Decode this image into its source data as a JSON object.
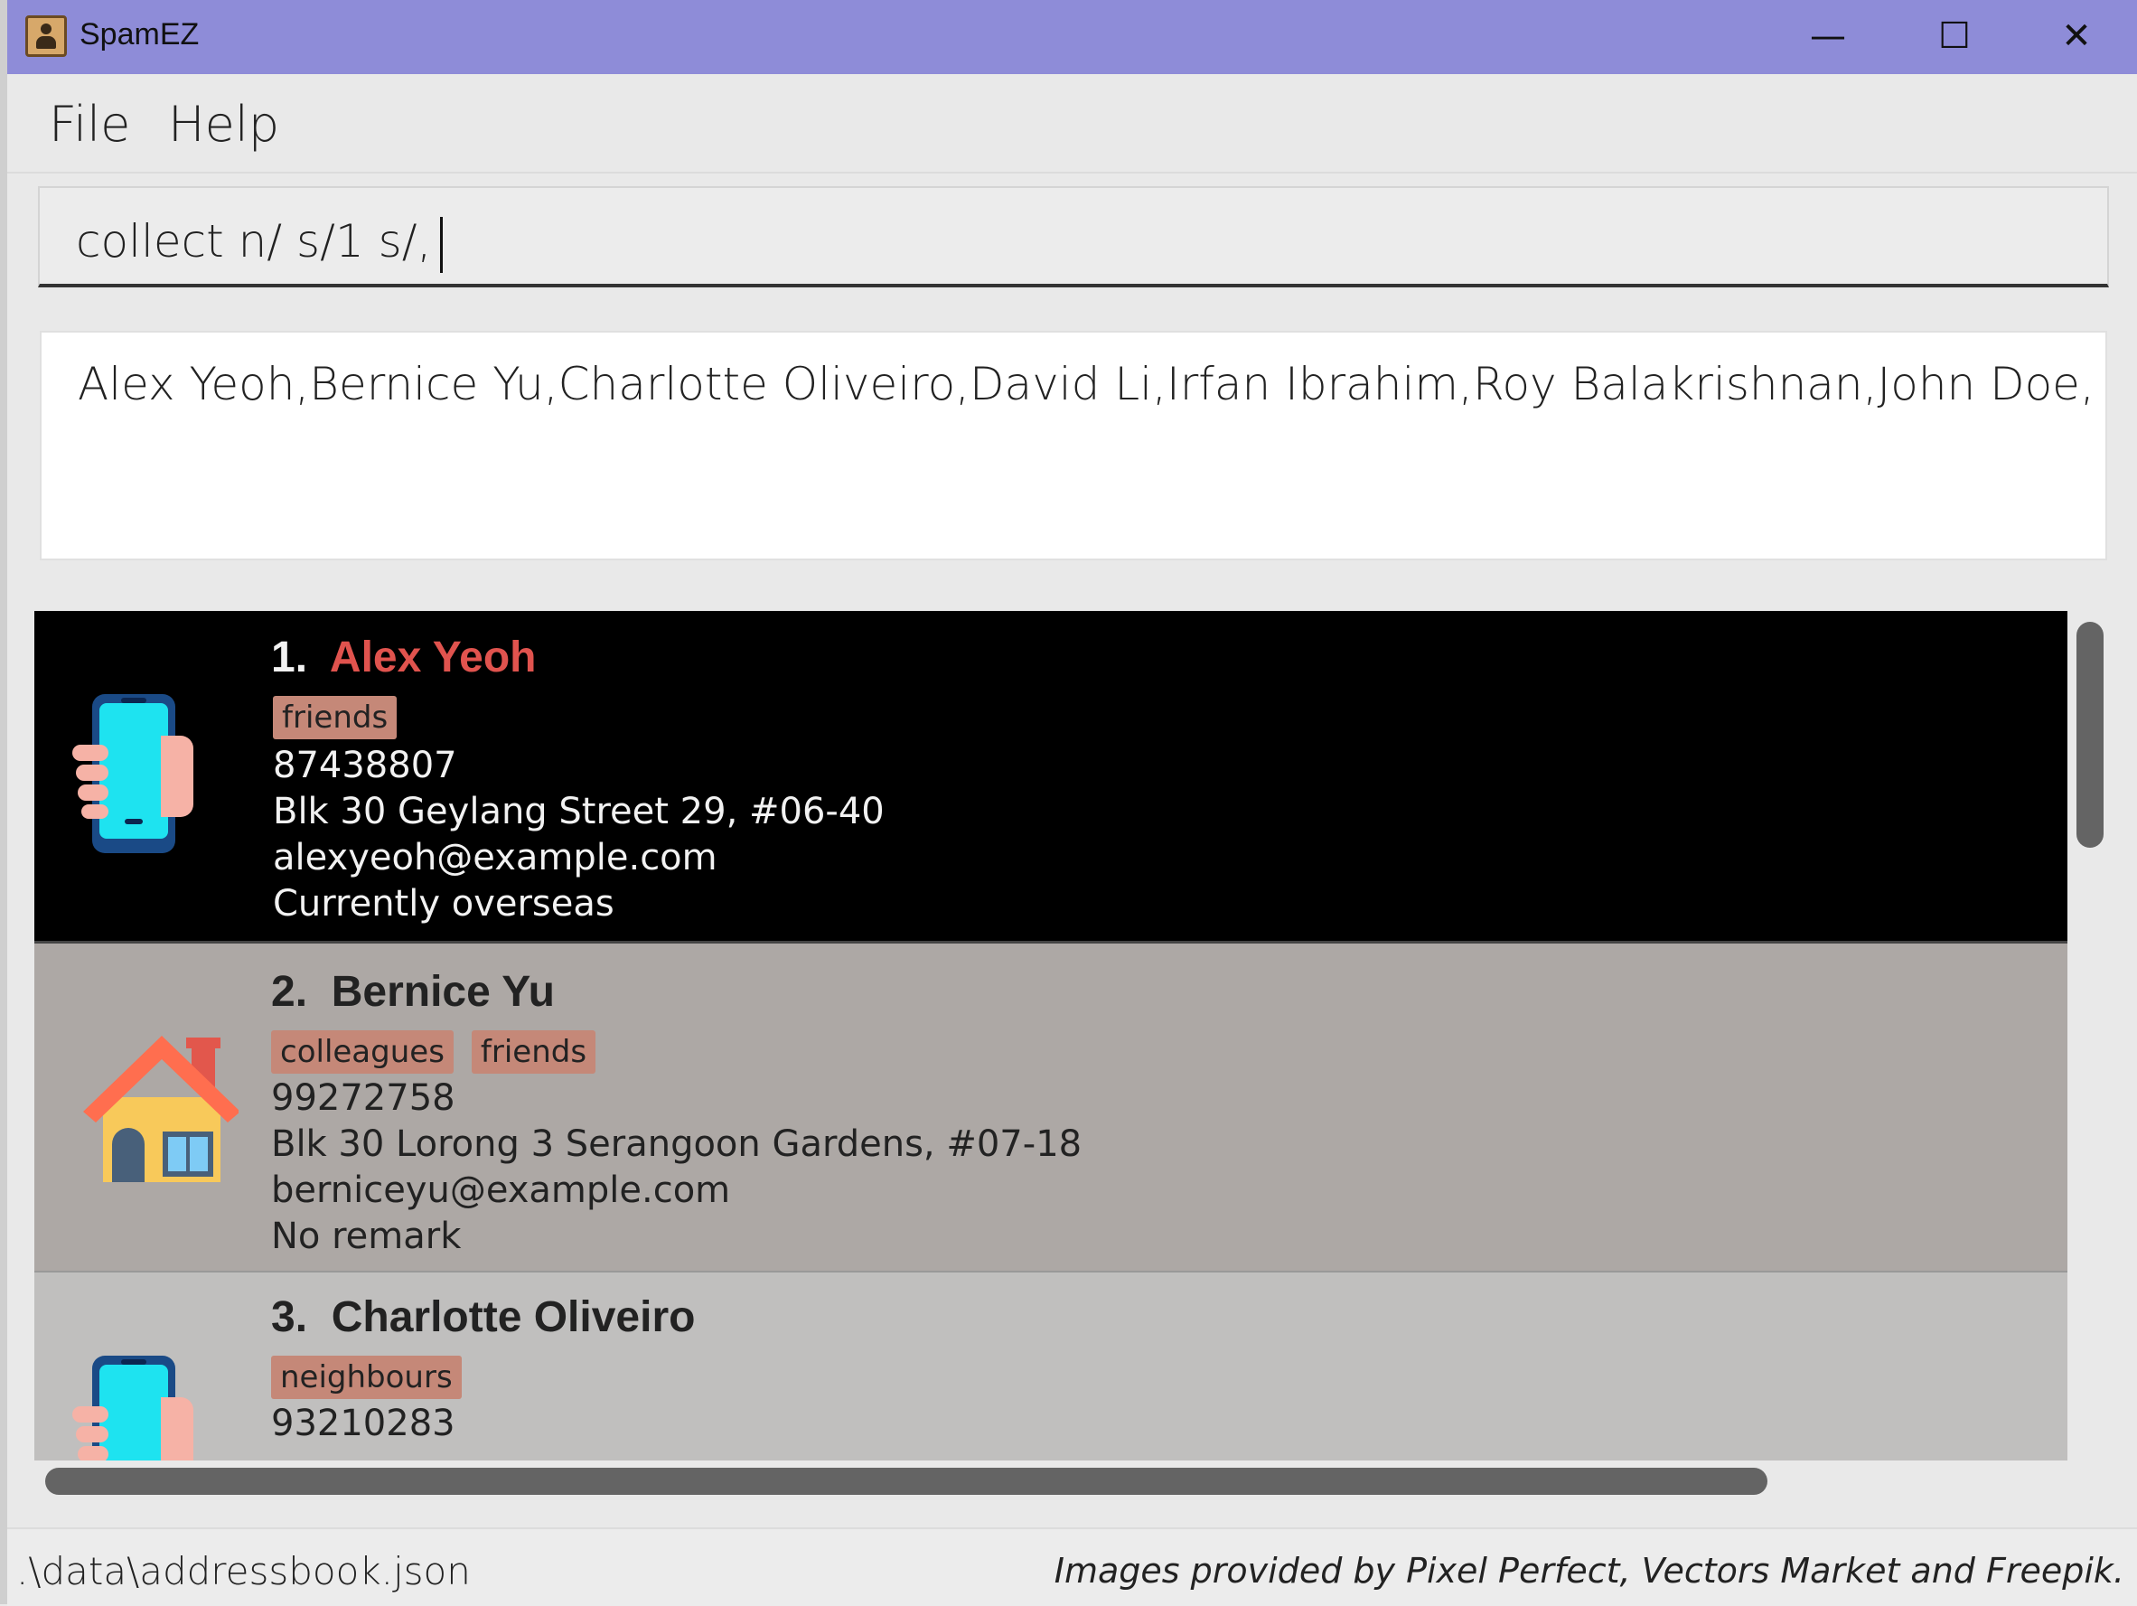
{
  "window": {
    "title": "SpamEZ"
  },
  "menu": {
    "file": "File",
    "help": "Help"
  },
  "command": {
    "value": "collect n/ s/1 s/,"
  },
  "result": {
    "text": "Alex Yeoh,Bernice Yu,Charlotte Oliveiro,David Li,Irfan Ibrahim,Roy Balakrishnan,John Doe,"
  },
  "persons": [
    {
      "index": "1.",
      "name": "Alex Yeoh",
      "tags": [
        "friends"
      ],
      "phone": "87438807",
      "address": "Blk 30 Geylang Street 29, #06-40",
      "email": "alexyeoh@example.com",
      "remark": "Currently overseas",
      "icon": "phone-in-hand-icon",
      "selected": true
    },
    {
      "index": "2.",
      "name": "Bernice Yu",
      "tags": [
        "colleagues",
        "friends"
      ],
      "phone": "99272758",
      "address": "Blk 30 Lorong 3 Serangoon Gardens, #07-18",
      "email": "berniceyu@example.com",
      "remark": "No remark",
      "icon": "house-icon",
      "selected": false
    },
    {
      "index": "3.",
      "name": "Charlotte Oliveiro",
      "tags": [
        "neighbours"
      ],
      "phone": "93210283",
      "icon": "phone-in-hand-icon",
      "selected": false
    }
  ],
  "status": {
    "path": ".\\data\\addressbook.json",
    "credit": "Images provided by Pixel Perfect, Vectors Market and Freepik."
  },
  "colors": {
    "titlebar": "#8e8cd8",
    "selected_card": "#000000",
    "selected_name": "#e0534e",
    "tag": "#c58878",
    "card_alt": "#ada8a5"
  }
}
